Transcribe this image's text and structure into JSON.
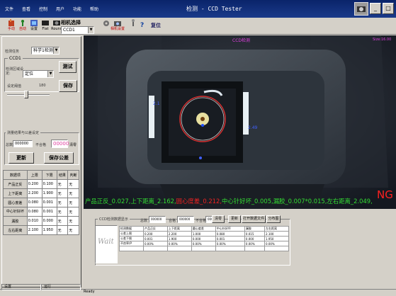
{
  "menu": [
    "文件",
    "查看",
    "控制",
    "用户",
    "功能",
    "帮助"
  ],
  "title": "检测 - CCD Tester",
  "window_buttons": [
    "_",
    "□",
    "×"
  ],
  "toolbar": {
    "items": [
      {
        "label": "手动",
        "icon": "hand-icon"
      },
      {
        "label": "自动",
        "icon": "run-icon"
      },
      {
        "label": "设置",
        "icon": "settings-icon"
      },
      {
        "label": "Flat",
        "icon": "flat-icon"
      },
      {
        "label": "Round",
        "icon": "round-icon"
      }
    ],
    "camera_select_label": "相机选择",
    "camera_select_value": "CCD1",
    "camera_settings_label": "相机设置",
    "reset_label": "复位",
    "question_label": "?"
  },
  "left": {
    "task_label": "检测任务",
    "task_value": "科学1检测",
    "ccd_label": "CCD1",
    "region_label": "检测区域设定:",
    "region_value": "定位",
    "test_button": "测试",
    "threshold_label": "设定阈值",
    "threshold_value": "180",
    "save_button": "保存",
    "stats_title": "测量结果与公差设定",
    "total_label": "总数",
    "total_value": "000000",
    "ng_label": "不合格",
    "ng_value": "00000",
    "clear_button": "清零",
    "update_button": "更新",
    "save_tol_button": "保存公差",
    "table_headers": [
      "数据项",
      "上限",
      "下限",
      "结果",
      "判断"
    ],
    "table_rows": [
      [
        "产品正反",
        "0.200",
        "0.100",
        "无",
        "无"
      ],
      [
        "上下距离",
        "2.200",
        "1.900",
        "无",
        "无"
      ],
      [
        "圆心度差",
        "0.080",
        "0.001",
        "无",
        "无"
      ],
      [
        "中心针好坏",
        "0.080",
        "0.001",
        "无",
        "无"
      ],
      [
        "漏胶",
        "0.010",
        "0.000",
        "无",
        "无"
      ],
      [
        "左右距离",
        "2.100",
        "1.950",
        "无",
        "无"
      ]
    ]
  },
  "camera": {
    "title": "CCD检测",
    "corner_label": "Size:16.00",
    "measure_label": "2.49",
    "result": "NG",
    "overlay": [
      {
        "text": "产品正反_0.027,",
        "color": "#33dd33"
      },
      {
        "text": "上下距离_2.162,",
        "color": "#33dd33"
      },
      {
        "text": "圆心度差_0.212,",
        "color": "#ee2222"
      },
      {
        "text": "中心针好坏_0.005,",
        "color": "#33dd33"
      },
      {
        "text": "漏胶_0.007*0.015,",
        "color": "#33dd33"
      },
      {
        "text": "左右距离_2.049,",
        "color": "#33dd33"
      }
    ]
  },
  "bottom": {
    "group_title": "CCD检测数据显示",
    "total_label": "总数",
    "total_value": "000000",
    "ok_label": "合格",
    "ok_value": "000000",
    "ng_label": "不合格",
    "ng_value": "000000",
    "clear_button": "清零",
    "update_button": "更新",
    "open_file_button": "打开数据文件",
    "dist_button": "分布图",
    "wait_text": "Wait",
    "table_headers": [
      "检测数据",
      "产品正反",
      "上下距离",
      "圆心度差",
      "中心针好坏",
      "漏胶",
      "左右距离"
    ],
    "table_rows": [
      [
        "公差上限",
        "0.200",
        "2.200",
        "1.000",
        "0.080",
        "0.015",
        "2.100"
      ],
      [
        "公差下限",
        "0.001",
        "1.900",
        "0.000",
        "0.001",
        "0.000",
        "1.950"
      ],
      [
        "不良率(P",
        "0.00%",
        "0.00%",
        "0.00%",
        "0.00%",
        "0.00%",
        "0.00%"
      ]
    ]
  },
  "status": {
    "settings": "设置",
    "run": "运行",
    "ready": "Ready"
  }
}
